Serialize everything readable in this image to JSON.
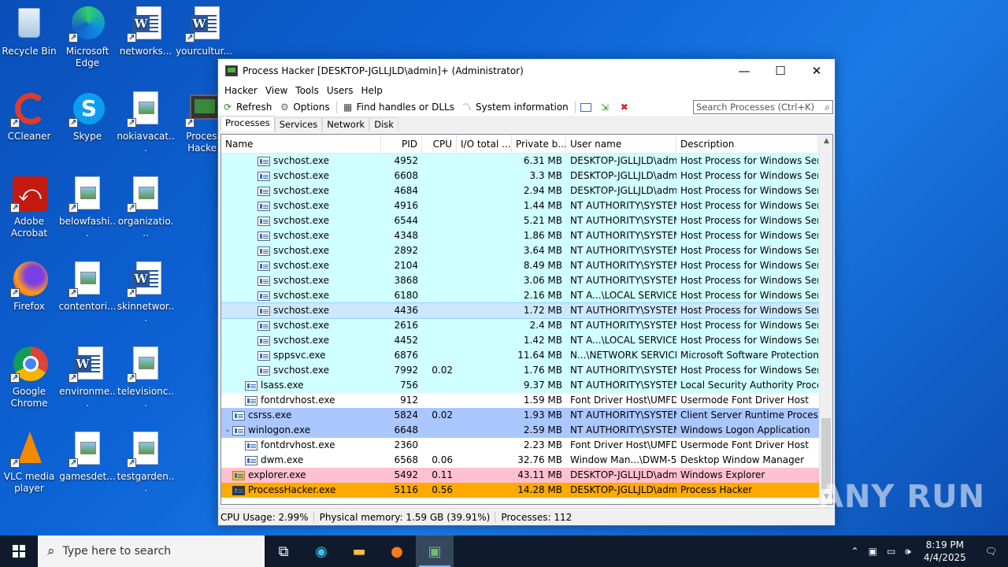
{
  "desktop": {
    "icons": [
      {
        "label": "Recycle Bin"
      },
      {
        "label": "Microsoft Edge"
      },
      {
        "label": "networks..."
      },
      {
        "label": "yourcultur..."
      },
      {
        "label": "CCleaner"
      },
      {
        "label": "Skype"
      },
      {
        "label": "nokiavacat..."
      },
      {
        "label": "Process Hacker"
      },
      {
        "label": "Adobe Acrobat"
      },
      {
        "label": "belowfashi..."
      },
      {
        "label": "organizatio..."
      },
      {
        "label": "Firefox"
      },
      {
        "label": "contentori..."
      },
      {
        "label": "skinnetwor..."
      },
      {
        "label": "Google Chrome"
      },
      {
        "label": "environme..."
      },
      {
        "label": "televisionc..."
      },
      {
        "label": "VLC media player"
      },
      {
        "label": "gamesdet..."
      },
      {
        "label": "testgarden..."
      }
    ]
  },
  "window": {
    "title": "Process Hacker [DESKTOP-JGLLJLD\\admin]+ (Administrator)",
    "minimize": "—",
    "maximize": "☐",
    "close": "✕"
  },
  "menu": [
    "Hacker",
    "View",
    "Tools",
    "Users",
    "Help"
  ],
  "toolbar": {
    "refresh": "Refresh",
    "options": "Options",
    "find": "Find handles or DLLs",
    "sysinfo": "System information",
    "search_placeholder": "Search Processes (Ctrl+K)"
  },
  "tabs": [
    "Processes",
    "Services",
    "Network",
    "Disk"
  ],
  "columns": {
    "name": "Name",
    "pid": "PID",
    "cpu": "CPU",
    "io": "I/O total ...",
    "priv": "Private b...",
    "user": "User name",
    "desc": "Description"
  },
  "processes": [
    {
      "name": "svchost.exe",
      "pid": "4952",
      "cpu": "",
      "priv": "6.31 MB",
      "user": "DESKTOP-JGLLJLD\\admi",
      "desc": "Host Process for Windows Ser..."
    },
    {
      "name": "svchost.exe",
      "pid": "6608",
      "cpu": "",
      "priv": "3.3 MB",
      "user": "DESKTOP-JGLLJLD\\admi",
      "desc": "Host Process for Windows Ser..."
    },
    {
      "name": "svchost.exe",
      "pid": "4684",
      "cpu": "",
      "priv": "2.94 MB",
      "user": "DESKTOP-JGLLJLD\\admi",
      "desc": "Host Process for Windows Ser..."
    },
    {
      "name": "svchost.exe",
      "pid": "4916",
      "cpu": "",
      "priv": "1.44 MB",
      "user": "NT AUTHORITY\\SYSTEM",
      "desc": "Host Process for Windows Ser..."
    },
    {
      "name": "svchost.exe",
      "pid": "6544",
      "cpu": "",
      "priv": "5.21 MB",
      "user": "NT AUTHORITY\\SYSTEM",
      "desc": "Host Process for Windows Ser..."
    },
    {
      "name": "svchost.exe",
      "pid": "4348",
      "cpu": "",
      "priv": "1.86 MB",
      "user": "NT AUTHORITY\\SYSTEM",
      "desc": "Host Process for Windows Ser..."
    },
    {
      "name": "svchost.exe",
      "pid": "2892",
      "cpu": "",
      "priv": "3.64 MB",
      "user": "NT AUTHORITY\\SYSTEM",
      "desc": "Host Process for Windows Ser..."
    },
    {
      "name": "svchost.exe",
      "pid": "2104",
      "cpu": "",
      "priv": "8.49 MB",
      "user": "NT AUTHORITY\\SYSTEM",
      "desc": "Host Process for Windows Ser..."
    },
    {
      "name": "svchost.exe",
      "pid": "3868",
      "cpu": "",
      "priv": "3.06 MB",
      "user": "NT AUTHORITY\\SYSTEM",
      "desc": "Host Process for Windows Ser..."
    },
    {
      "name": "svchost.exe",
      "pid": "6180",
      "cpu": "",
      "priv": "2.16 MB",
      "user": "NT A...\\LOCAL SERVICE",
      "desc": "Host Process for Windows Ser..."
    },
    {
      "name": "svchost.exe",
      "pid": "4436",
      "cpu": "",
      "priv": "1.72 MB",
      "user": "NT AUTHORITY\\SYSTEM",
      "desc": "Host Process for Windows Ser..."
    },
    {
      "name": "svchost.exe",
      "pid": "2616",
      "cpu": "",
      "priv": "2.4 MB",
      "user": "NT AUTHORITY\\SYSTEM",
      "desc": "Host Process for Windows Ser..."
    },
    {
      "name": "svchost.exe",
      "pid": "4452",
      "cpu": "",
      "priv": "1.42 MB",
      "user": "NT A...\\LOCAL SERVICE",
      "desc": "Host Process for Windows Ser..."
    },
    {
      "name": "sppsvc.exe",
      "pid": "6876",
      "cpu": "",
      "priv": "11.64 MB",
      "user": "N...\\NETWORK SERVICE",
      "desc": "Microsoft Software Protection..."
    },
    {
      "name": "svchost.exe",
      "pid": "7992",
      "cpu": "0.02",
      "priv": "1.76 MB",
      "user": "NT AUTHORITY\\SYSTEM",
      "desc": "Host Process for Windows Ser..."
    },
    {
      "name": "lsass.exe",
      "pid": "756",
      "cpu": "",
      "priv": "9.37 MB",
      "user": "NT AUTHORITY\\SYSTEM",
      "desc": "Local Security Authority Proce..."
    },
    {
      "name": "fontdrvhost.exe",
      "pid": "912",
      "cpu": "",
      "priv": "1.59 MB",
      "user": "Font Driver Host\\UMFD-",
      "desc": "Usermode Font Driver Host"
    },
    {
      "name": "csrss.exe",
      "pid": "5824",
      "cpu": "0.02",
      "priv": "1.93 MB",
      "user": "NT AUTHORITY\\SYSTEM",
      "desc": "Client Server Runtime Process"
    },
    {
      "name": "winlogon.exe",
      "pid": "6648",
      "cpu": "",
      "priv": "2.59 MB",
      "user": "NT AUTHORITY\\SYSTEM",
      "desc": "Windows Logon Application"
    },
    {
      "name": "fontdrvhost.exe",
      "pid": "2360",
      "cpu": "",
      "priv": "2.23 MB",
      "user": "Font Driver Host\\UMFD-",
      "desc": "Usermode Font Driver Host"
    },
    {
      "name": "dwm.exe",
      "pid": "6568",
      "cpu": "0.06",
      "priv": "32.76 MB",
      "user": "Window Man...\\DWM-5",
      "desc": "Desktop Window Manager"
    },
    {
      "name": "explorer.exe",
      "pid": "5492",
      "cpu": "0.11",
      "priv": "43.11 MB",
      "user": "DESKTOP-JGLLJLD\\admi",
      "desc": "Windows Explorer"
    },
    {
      "name": "ProcessHacker.exe",
      "pid": "5116",
      "cpu": "0.56",
      "priv": "14.28 MB",
      "user": "DESKTOP-JGLLJLD\\admi",
      "desc": "Process Hacker"
    }
  ],
  "row_colors": {
    "service": "#d0ffff",
    "selected": "#cce8ff",
    "system": "#aac8ff",
    "normal": "#ffffff",
    "explorer": "#ffc0d0",
    "own": "#ffaa00"
  },
  "status": {
    "cpu": "CPU Usage: 2.99%",
    "mem": "Physical memory: 1.59 GB (39.91%)",
    "procs": "Processes: 112"
  },
  "taskbar": {
    "search_placeholder": "Type here to search",
    "time": "8:19 PM",
    "date": "4/4/2025"
  },
  "watermark": "ANY RUN"
}
